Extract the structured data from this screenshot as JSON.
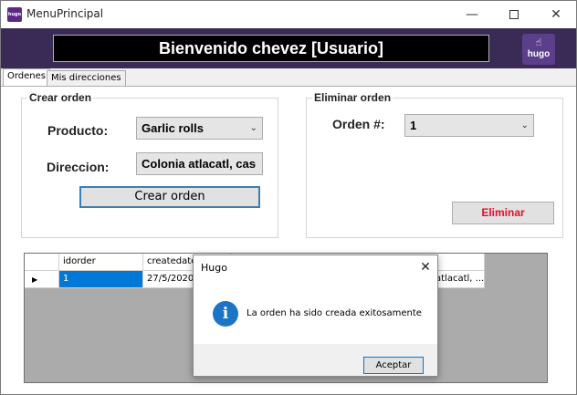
{
  "window": {
    "title": "MenuPrincipal",
    "app_icon_text": "hugo",
    "minimize_symbol": "—",
    "close_symbol": "✕"
  },
  "header": {
    "welcome": "Bienvenido chevez [Usuario]",
    "logo_text": "hugo"
  },
  "tabs": [
    {
      "label": "Ordenes",
      "active": true
    },
    {
      "label": "Mis direcciones",
      "active": false
    }
  ],
  "crear_orden": {
    "title": "Crear orden",
    "producto_label": "Producto:",
    "producto_value": "Garlic rolls",
    "direccion_label": "Direccion:",
    "direccion_value": "Colonia atlacatl, cas",
    "button": "Crear orden"
  },
  "eliminar_orden": {
    "title": "Eliminar orden",
    "orden_label": "Orden #:",
    "orden_value": "1",
    "button": "Eliminar"
  },
  "grid": {
    "columns": [
      "idorder",
      "createdate"
    ],
    "rows": [
      {
        "idorder": "1",
        "createdate": "27/5/2020",
        "address_tail": "atlacatl, ..."
      }
    ]
  },
  "dialog": {
    "title": "Hugo",
    "message": "La orden ha sido creada exitosamente",
    "ok_button": "Aceptar",
    "close_symbol": "✕",
    "info_glyph": "i"
  },
  "colors": {
    "header_bg": "#3a2a56",
    "accent_focus": "#3c7fb1",
    "danger_text": "#e0102a",
    "info_icon": "#1b75c4",
    "selected_row": "#0078d7"
  },
  "icons": [
    "app-icon",
    "hand-logo-icon",
    "chevron-down-icon",
    "info-icon",
    "row-pointer-icon"
  ]
}
